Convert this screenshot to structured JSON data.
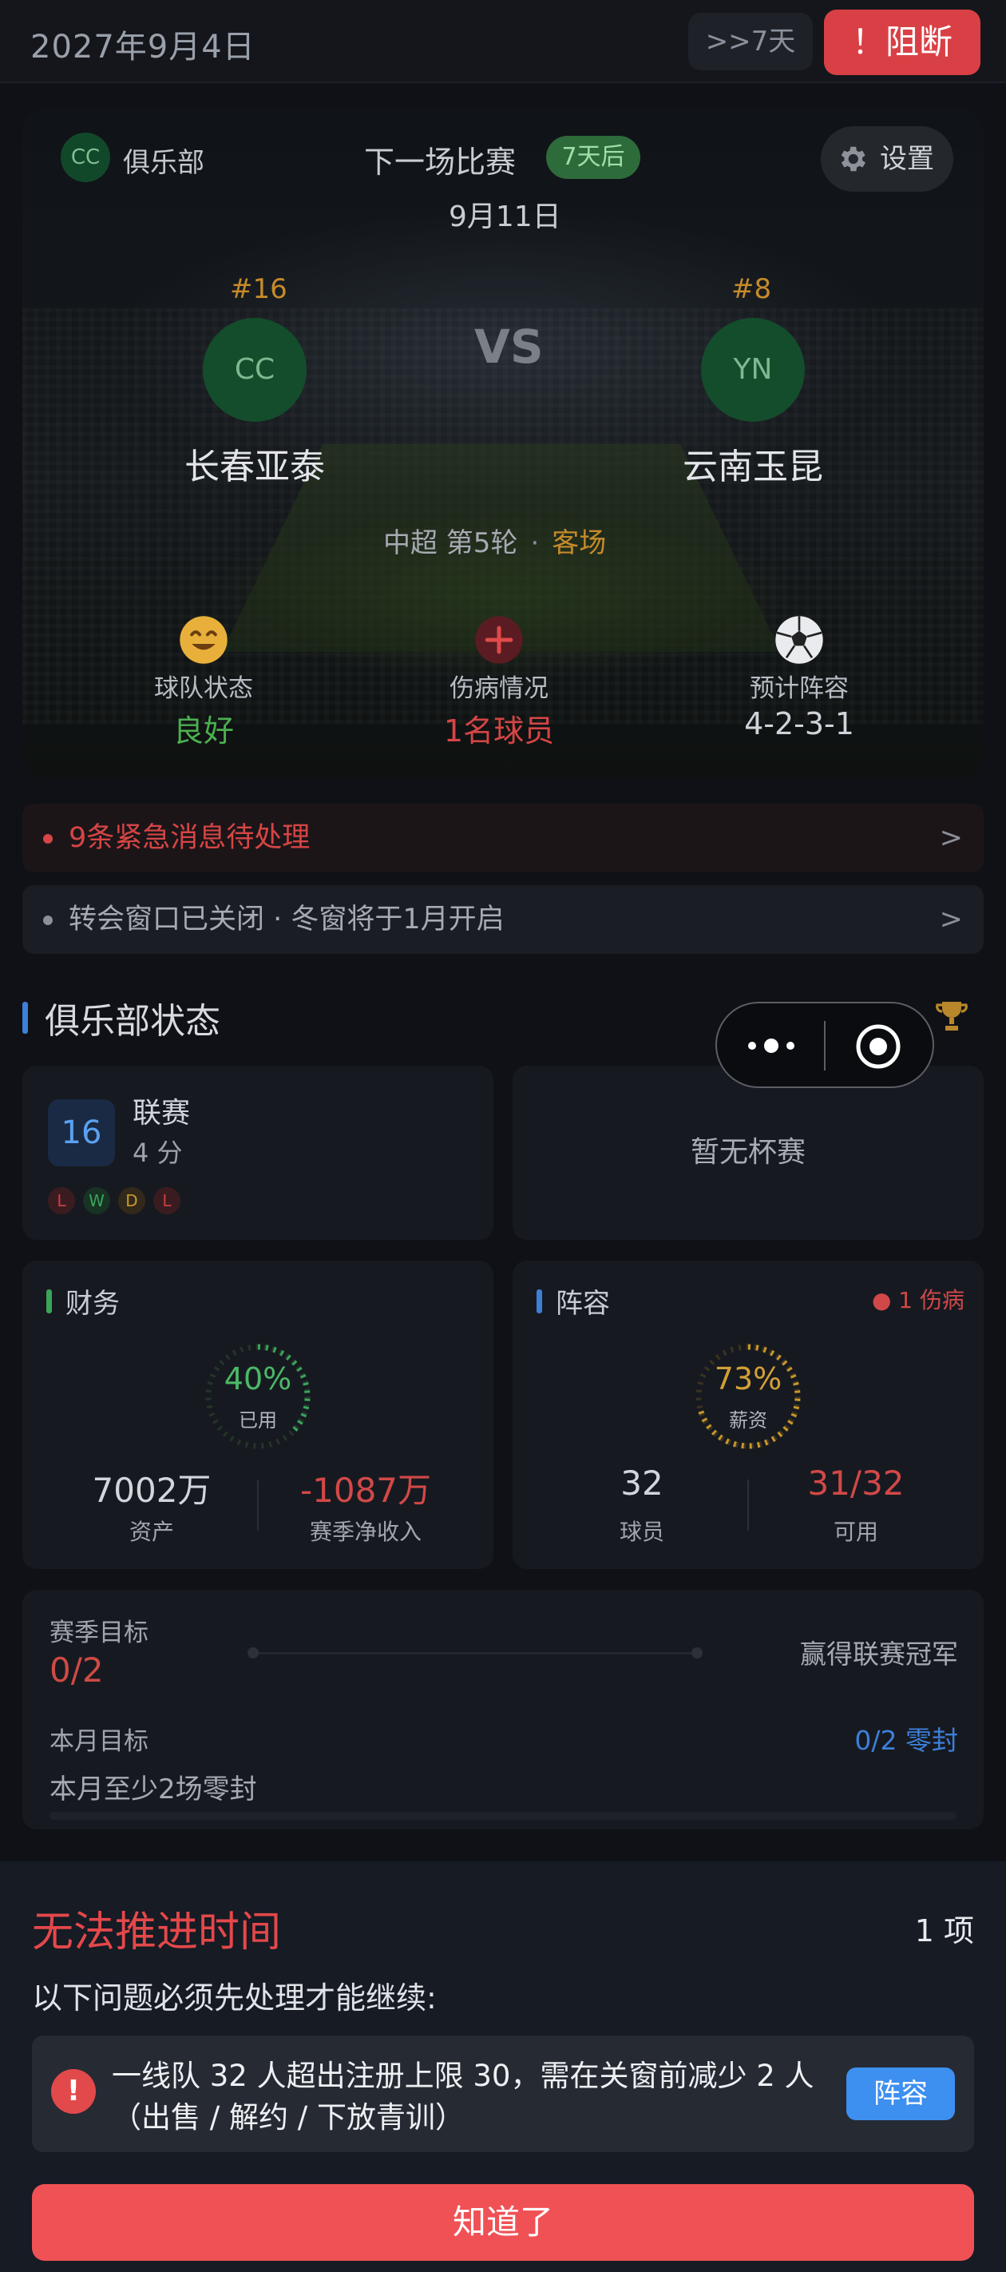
{
  "topbar": {
    "date": "2027年9月4日",
    "skip_label": ">>7天",
    "block_label": "！阻断"
  },
  "match": {
    "club_badge": "CC",
    "club_label": "俱乐部",
    "title": "下一场比赛",
    "days_badge": "7天后",
    "date": "9月11日",
    "settings_label": "设置",
    "vs": "VS",
    "home": {
      "rank": "#16",
      "abbr": "CC",
      "name": "长春亚泰"
    },
    "away": {
      "rank": "#8",
      "abbr": "YN",
      "name": "云南玉昆"
    },
    "league": "中超 第5轮",
    "separator": "·",
    "venue": "客场",
    "stats": [
      {
        "icon": "smile-face-icon",
        "label": "球队状态",
        "value": "良好",
        "color": "#4caf50"
      },
      {
        "icon": "medical-cross-icon",
        "label": "伤病情况",
        "value": "1名球员",
        "color": "#d64545"
      },
      {
        "icon": "soccer-ball-icon",
        "label": "预计阵容",
        "value": "4-2-3-1",
        "color": "#d0d3d9"
      }
    ]
  },
  "notices": [
    {
      "text": "9条紧急消息待处理",
      "arrow": ">",
      "color": "#d64545"
    },
    {
      "text": "转会窗口已关闭 · 冬窗将于1月开启",
      "arrow": ">",
      "color": "#a6aab2"
    }
  ],
  "status": {
    "title": "俱乐部状态",
    "league": {
      "rank": "16",
      "name": "联赛",
      "points": "4 分",
      "form": [
        {
          "r": "L",
          "color": "#c84040"
        },
        {
          "r": "W",
          "color": "#3aa55a"
        },
        {
          "r": "D",
          "color": "#c89a2a"
        },
        {
          "r": "L",
          "color": "#c84040"
        }
      ]
    },
    "cup": {
      "text": "暂无杯赛"
    },
    "finance": {
      "title": "财务",
      "percent": "40%",
      "percent_value": 40,
      "ring_label": "已用",
      "assets": "7002万",
      "assets_label": "资产",
      "net": "-1087万",
      "net_label": "赛季净收入"
    },
    "squad": {
      "title": "阵容",
      "injury_badge": "● 1 伤病",
      "percent": "73%",
      "percent_value": 73,
      "ring_label": "薪资",
      "players": "32",
      "players_label": "球员",
      "available": "31/32",
      "available_label": "可用"
    },
    "goals": {
      "season_label": "赛季目标",
      "season_value": "0/2",
      "season_text": "赢得联赛冠军",
      "month_label": "本月目标",
      "month_value": "0/2 零封",
      "month_text": "本月至少2场零封"
    }
  },
  "sheet": {
    "title": "无法推进时间",
    "count": "1 项",
    "subtitle": "以下问题必须先处理才能继续:",
    "issue_icon": "!",
    "issue_line1": "一线队 32 人超出注册上限 30，需在关窗前减少 2 人",
    "issue_line2": "（出售 / 解约 / 下放青训）",
    "issue_button": "阵容",
    "ok_button": "知道了"
  },
  "colors": {
    "accent_red": "#f05155",
    "accent_blue": "#3d8ff0",
    "accent_green": "#4caf50",
    "gold": "#c58a2a"
  }
}
